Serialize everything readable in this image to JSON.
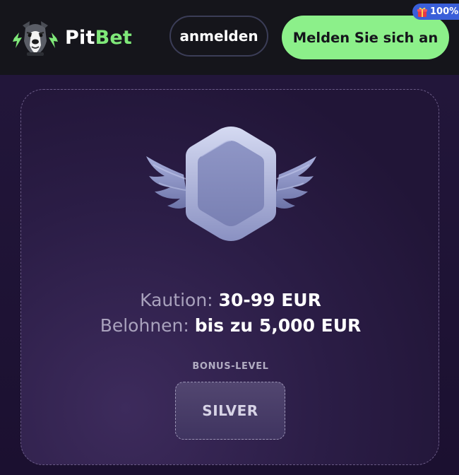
{
  "header": {
    "brand_prefix": "Pit",
    "brand_suffix": "Bet",
    "login_label": "anmelden",
    "register_label": "Melden Sie sich an",
    "zoom_badge": "100%"
  },
  "reward": {
    "deposit_label": "Kaution:",
    "deposit_value": "30-99 EUR",
    "reward_label": "Belohnen:",
    "reward_value": "bis zu 5,000 EUR"
  },
  "bonus": {
    "title": "BONUS-LEVEL",
    "level": "SILVER"
  },
  "colors": {
    "accent_green": "#8cf08a",
    "badge_blue": "#3a5fd9",
    "background": "#1e1230"
  },
  "icons": [
    "pitbull-logo-icon",
    "silver-badge-icon",
    "gift-icon"
  ]
}
